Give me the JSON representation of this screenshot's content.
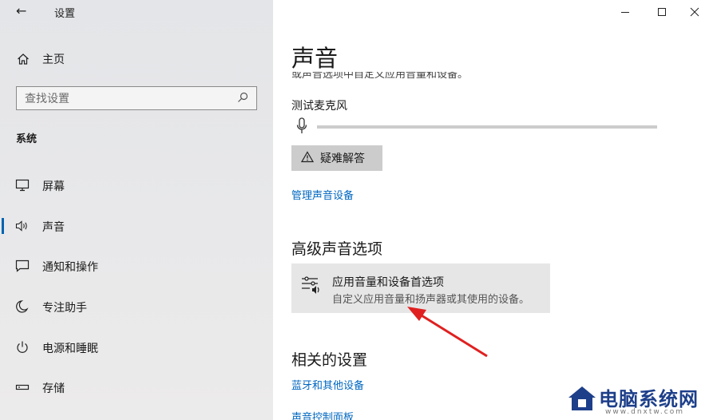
{
  "window": {
    "title": "设置",
    "back_icon": "back-arrow-icon"
  },
  "sidebar": {
    "home_label": "主页",
    "search_placeholder": "查找设置",
    "section_label": "系统",
    "items": [
      {
        "label": "屏幕",
        "icon": "monitor-icon"
      },
      {
        "label": "声音",
        "icon": "speaker-icon",
        "active": true
      },
      {
        "label": "通知和操作",
        "icon": "notification-icon"
      },
      {
        "label": "专注助手",
        "icon": "moon-icon"
      },
      {
        "label": "电源和睡眠",
        "icon": "power-icon"
      },
      {
        "label": "存储",
        "icon": "storage-icon"
      }
    ],
    "accent": "#0063b1"
  },
  "main": {
    "title": "声音",
    "clipped_text": "或声音选项中自定义应用音量和设备。",
    "mic_label": "测试麦克风",
    "mic_level": 0,
    "troubleshoot_label": "疑难解答",
    "manage_link": "管理声音设备",
    "advanced_heading": "高级声音选项",
    "advanced_item": {
      "title": "应用音量和设备首选项",
      "desc": "自定义应用音量和扬声器或其使用的设备。"
    },
    "related_heading": "相关的设置",
    "related_links": [
      "蓝牙和其他设备",
      "声音控制面板"
    ],
    "link_color": "#0067c0"
  },
  "annotation": {
    "arrow_color": "#e02020"
  },
  "watermark": {
    "brand": "电脑系统网",
    "url": "www.dnxtw.com"
  }
}
